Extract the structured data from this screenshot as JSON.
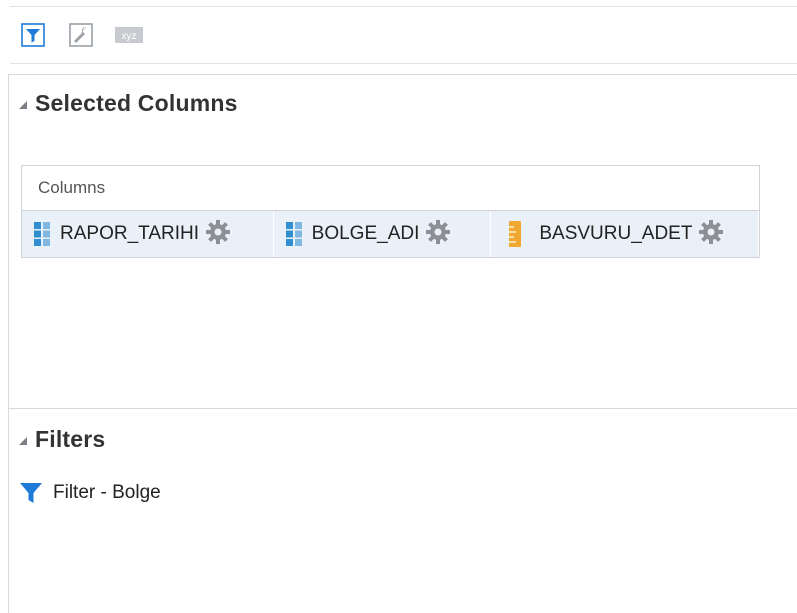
{
  "toolbar": {
    "buttons": [
      {
        "icon": "filter-icon"
      },
      {
        "icon": "edit-formula-icon"
      },
      {
        "icon": "xyz-icon",
        "label": "xyz"
      }
    ]
  },
  "selected_columns": {
    "title": "Selected Columns",
    "columns_label": "Columns",
    "items": [
      {
        "label": "RAPOR_TARIHI",
        "type": "attribute"
      },
      {
        "label": "BOLGE_ADI",
        "type": "attribute"
      },
      {
        "label": "BASVURU_ADET",
        "type": "measure"
      }
    ]
  },
  "filters": {
    "title": "Filters",
    "items": [
      {
        "label": "Filter - Bolge"
      }
    ]
  },
  "colors": {
    "accent": "#1e7bd8",
    "measure": "#f0a830",
    "attribute": "#2f8fd0",
    "gear": "#8c9096"
  }
}
